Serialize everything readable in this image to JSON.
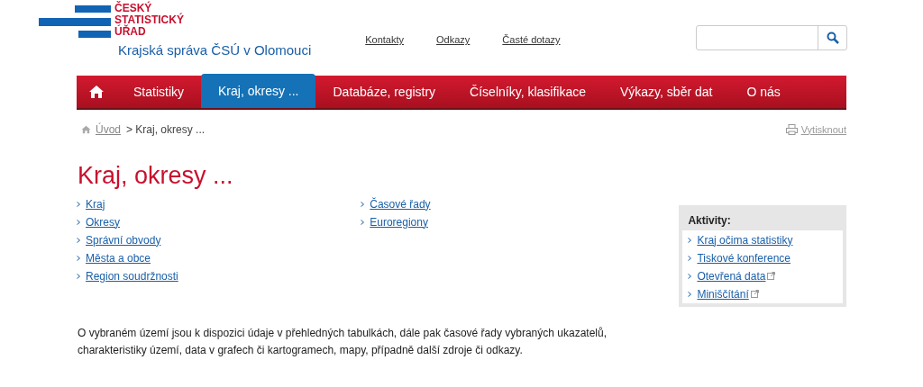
{
  "logo": {
    "lines": [
      "ČESKÝ",
      "STATISTICKÝ",
      "ÚŘAD"
    ],
    "subtitle": "Krajská správa ČSÚ v Olomouci"
  },
  "top_links": [
    "Kontakty",
    "Odkazy",
    "Časté dotazy"
  ],
  "nav": [
    {
      "label": "Statistiky",
      "selected": false
    },
    {
      "label": "Kraj, okresy ...",
      "selected": true
    },
    {
      "label": "Databáze, registry",
      "selected": false
    },
    {
      "label": "Číselníky, klasifikace",
      "selected": false
    },
    {
      "label": "Výkazy, sběr dat",
      "selected": false
    },
    {
      "label": "O nás",
      "selected": false
    }
  ],
  "breadcrumb": {
    "home": "Úvod",
    "current": "> Kraj, okresy ..."
  },
  "print": "Vytisknout",
  "title": "Kraj, okresy ...",
  "links_col_1": [
    "Kraj",
    "Okresy",
    "Správní obvody",
    "Města a obce",
    "Region soudržnosti"
  ],
  "links_col_2": [
    "Časové řady",
    "Euroregiony"
  ],
  "activities": {
    "heading": "Aktivity:",
    "items": [
      {
        "label": "Kraj očima statistiky",
        "external": false
      },
      {
        "label": "Tiskové konference",
        "external": false
      },
      {
        "label": "Otevřená data",
        "external": true
      },
      {
        "label": "Miniščítání",
        "external": true
      }
    ]
  },
  "description": "O vybraném území jsou k dispozici údaje v přehledných tabulkách, dále pak časové řady vybraných ukazatelů, charakteristiky území, data v grafech či kartogramech, mapy, případně další zdroje či odkazy."
}
